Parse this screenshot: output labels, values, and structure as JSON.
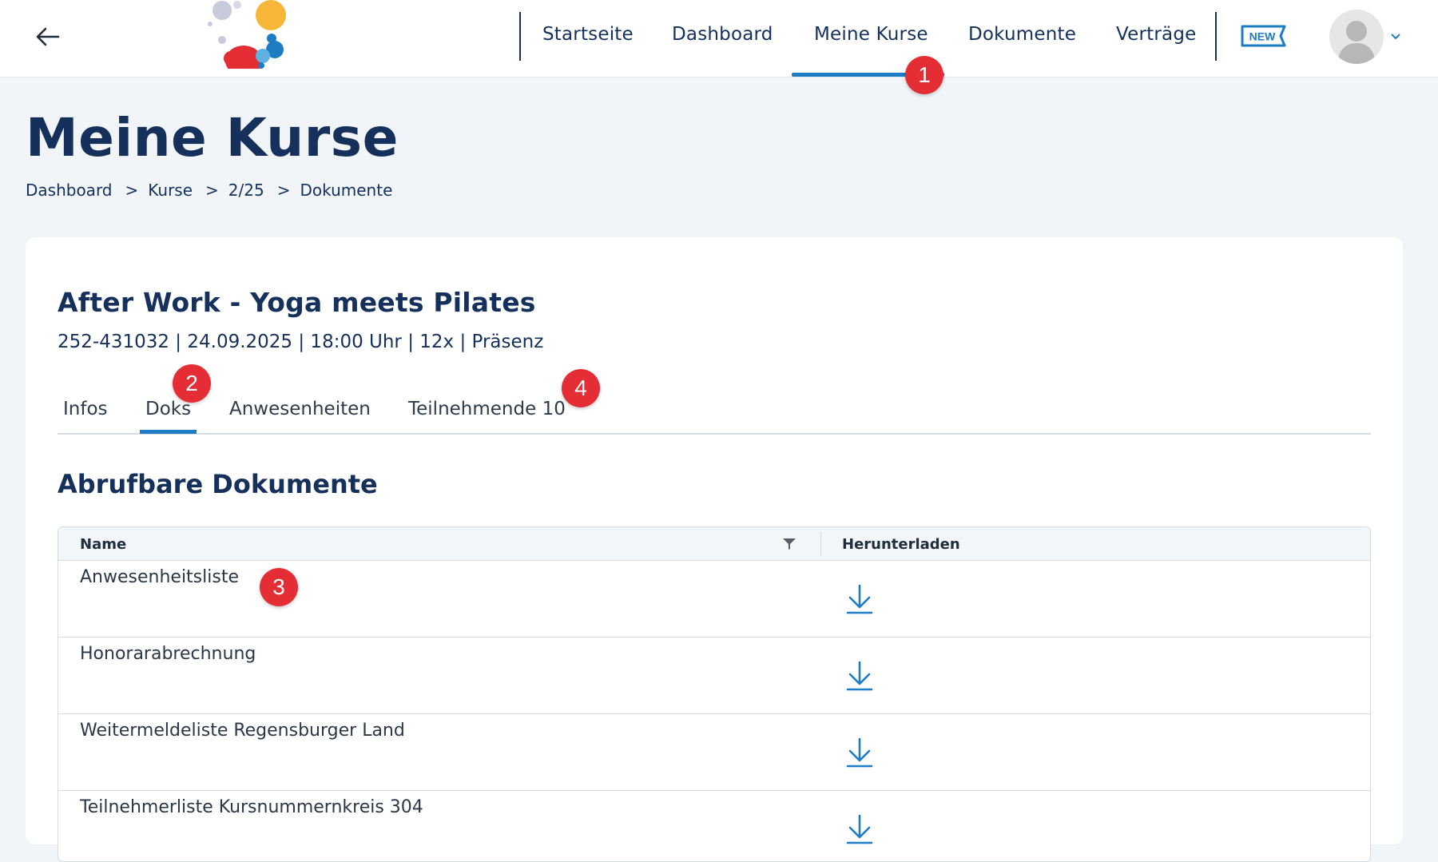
{
  "header": {
    "nav": [
      {
        "label": "Startseite"
      },
      {
        "label": "Dashboard"
      },
      {
        "label": "Meine Kurse"
      },
      {
        "label": "Dokumente"
      },
      {
        "label": "Verträge"
      }
    ],
    "new_badge": "NEW",
    "accent_color": "#1e7cc3"
  },
  "markers": [
    "1",
    "2",
    "3",
    "4"
  ],
  "page": {
    "title": "Meine Kurse",
    "breadcrumb": [
      "Dashboard",
      "Kurse",
      "2/25",
      "Dokumente"
    ],
    "breadcrumb_sep": ">"
  },
  "course": {
    "title": "After Work - Yoga meets Pilates",
    "meta": "252-431032 | 24.09.2025 | 18:00 Uhr | 12x | Präsenz"
  },
  "tabs": [
    {
      "label": "Infos"
    },
    {
      "label": "Doks"
    },
    {
      "label": "Anwesenheiten"
    },
    {
      "label": "Teilnehmende 10"
    }
  ],
  "documents": {
    "title": "Abrufbare Dokumente",
    "columns": {
      "name": "Name",
      "download": "Herunterladen"
    },
    "rows": [
      {
        "name": "Anwesenheitsliste"
      },
      {
        "name": "Honorarabrechnung"
      },
      {
        "name": "Weitermeldeliste Regensburger Land"
      },
      {
        "name": "Teilnehmerliste Kursnummernkreis 304"
      }
    ]
  }
}
